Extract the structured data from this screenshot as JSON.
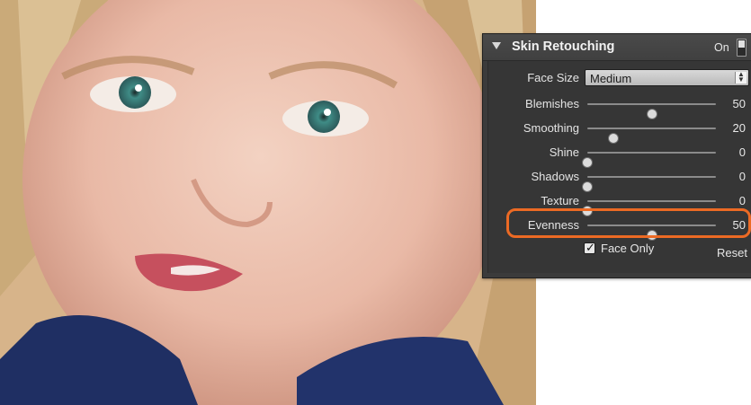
{
  "panel": {
    "title": "Skin Retouching",
    "on_label": "On",
    "face_size": {
      "label": "Face Size",
      "value": "Medium"
    },
    "sliders": [
      {
        "label": "Blemishes",
        "value": "50",
        "level": 0.5
      },
      {
        "label": "Smoothing",
        "value": "20",
        "level": 0.2
      },
      {
        "label": "Shine",
        "value": "0",
        "level": 0.0
      },
      {
        "label": "Shadows",
        "value": "0",
        "level": 0.0
      },
      {
        "label": "Texture",
        "value": "0",
        "level": 0.0
      },
      {
        "label": "Evenness",
        "value": "50",
        "level": 0.5
      }
    ],
    "face_only_label": "Face Only",
    "face_only_checked": true,
    "reset_label": "Reset"
  },
  "highlight_color": "#ec6a24",
  "icons": {
    "disclosure": "triangle-down-icon",
    "select_arrows": "up-down-arrows-icon",
    "checkbox": "checkmark-icon"
  }
}
